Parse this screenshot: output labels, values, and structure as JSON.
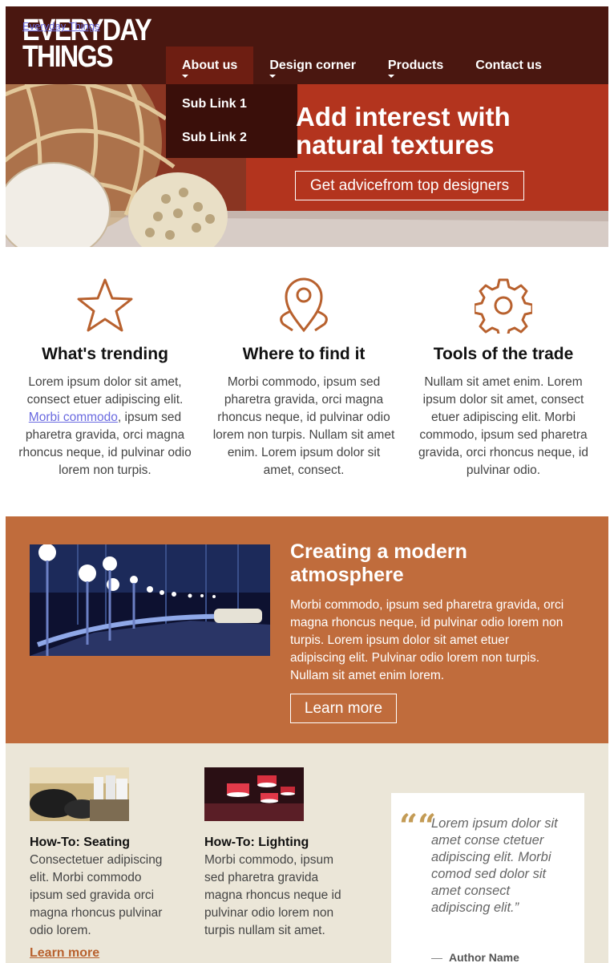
{
  "header": {
    "logo_text_line1": "EVERYDAY",
    "logo_text_line2": "THINGS",
    "logo_link": "Everyday Things",
    "nav": [
      {
        "label": "About us",
        "has_caret": true
      },
      {
        "label": "Design corner",
        "has_caret": true
      },
      {
        "label": "Products",
        "has_caret": true
      },
      {
        "label": "Contact us",
        "has_caret": false
      }
    ],
    "dropdown": [
      "Sub Link 1",
      "Sub Link 2"
    ]
  },
  "hero": {
    "title": "Add interest with natural textures",
    "button": "Get advicefrom top designers"
  },
  "features": [
    {
      "icon": "star-icon",
      "title": "What's trending",
      "text_before": "Lorem ipsum dolor sit amet, consect etuer adipiscing elit. ",
      "link": "Morbi commodo",
      "text_after": ", ipsum sed pharetra gravida, orci magna rhoncus neque, id pulvinar odio lorem non turpis."
    },
    {
      "icon": "map-pin-icon",
      "title": "Where to find it",
      "text": "Morbi commodo, ipsum sed pharetra gravida, orci magna rhoncus neque, id pulvinar odio lorem non turpis. Nullam sit amet enim. Lorem ipsum dolor sit amet, consect."
    },
    {
      "icon": "gear-icon",
      "title": "Tools of the trade",
      "text": "Nullam sit amet enim. Lorem ipsum dolor sit amet, consect etuer adipiscing elit. Morbi commodo, ipsum sed pharetra gravida, orci rhoncus neque, id pulvinar odio."
    }
  ],
  "promo": {
    "title": "Creating a modern atmosphere",
    "text": "Morbi commodo, ipsum sed pharetra gravida, orci magna rhoncus neque, id pulvinar odio lorem non turpis. Lorem ipsum dolor sit amet etuer adipiscing elit. Pulvinar odio lorem non turpis. Nullam sit amet enim lorem.",
    "button": "Learn more"
  },
  "cards": [
    {
      "title": "How-To: Seating",
      "text": "Consectetuer adipiscing elit. Morbi commodo ipsum sed gravida orci magna rhoncus pulvinar odio lorem.",
      "link": "Learn more"
    },
    {
      "title": "How-To: Lighting",
      "text": "Morbi commodo, ipsum sed pharetra gravida magna rhoncus neque id pulvinar odio lorem non turpis nullam sit amet."
    }
  ],
  "quote": {
    "mark": "““",
    "text": "Lorem ipsum dolor sit amet conse ctetuer adipiscing elit. Morbi comod sed dolor sit amet consect adipiscing elit.”",
    "author": "Author Name"
  },
  "colors": {
    "topbar": "#4a1710",
    "hero_red": "#c4381f",
    "promo_band": "#c06c3c",
    "bottom_bg": "#ebe6d8",
    "icon_stroke": "#b8612e"
  }
}
